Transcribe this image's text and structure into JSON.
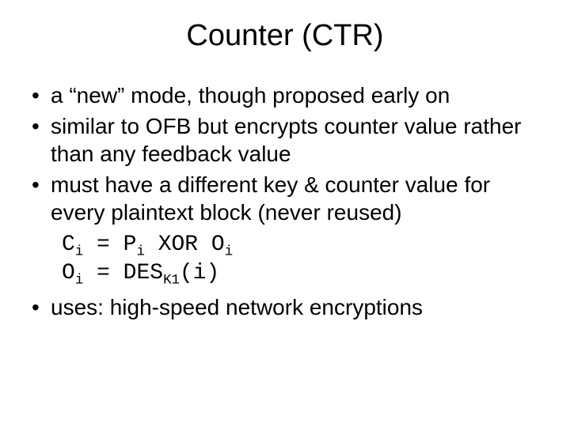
{
  "title": "Counter (CTR)",
  "bullets": {
    "b1": "a “new” mode, though proposed early on",
    "b2": "similar to OFB but encrypts counter value rather than any feedback value",
    "b3": "must have a different key & counter value for every plaintext block (never reused)",
    "b4": "uses: high-speed network encryptions"
  },
  "formulas": {
    "f1": {
      "lhs_base": "C",
      "lhs_sub": "i",
      "eq": " = ",
      "p_base": "P",
      "p_sub": "i",
      "mid": " XOR ",
      "o_base": "O",
      "o_sub": "i"
    },
    "f2": {
      "lhs_base": "O",
      "lhs_sub": "i",
      "eq": " = ",
      "fn": "DES",
      "fn_sub": "K1",
      "arg": "(i)"
    }
  }
}
